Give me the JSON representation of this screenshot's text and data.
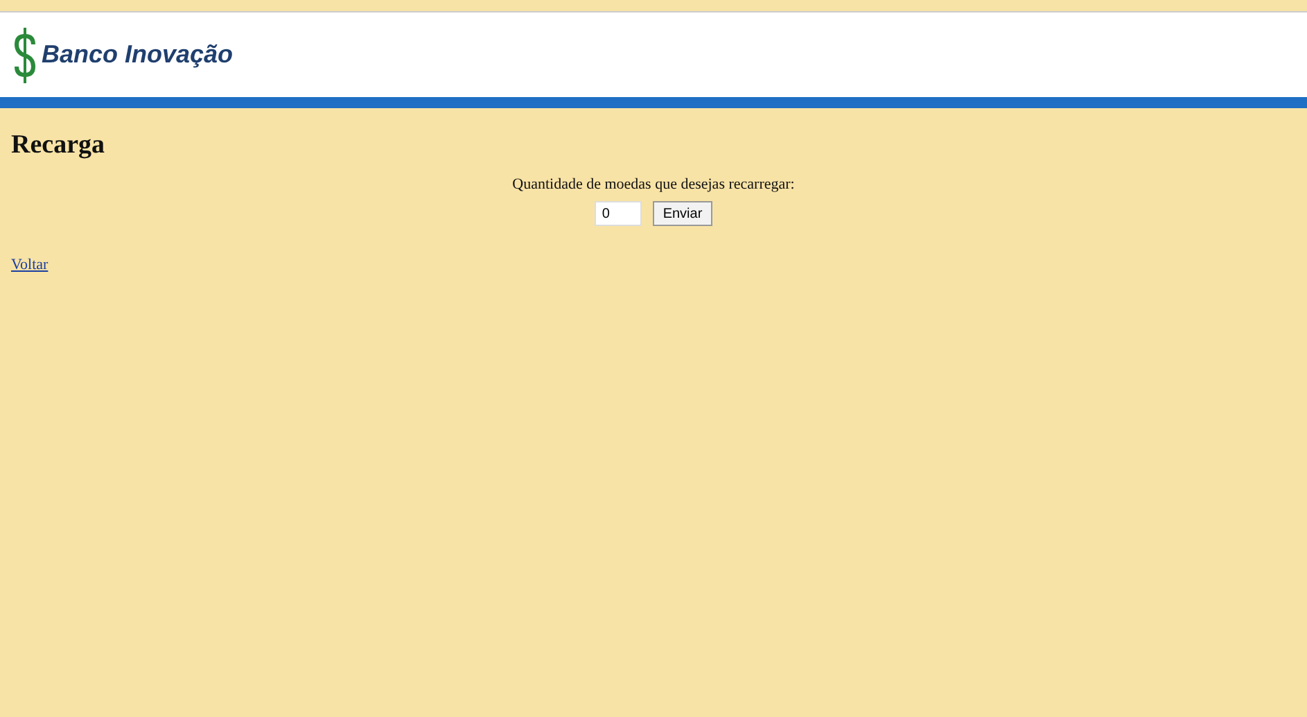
{
  "header": {
    "logo_text": "Banco Inovação"
  },
  "page": {
    "title": "Recarga",
    "prompt": "Quantidade de moedas que desejas recarregar:",
    "amount_value": "0",
    "submit_label": "Enviar",
    "back_link": "Voltar"
  }
}
